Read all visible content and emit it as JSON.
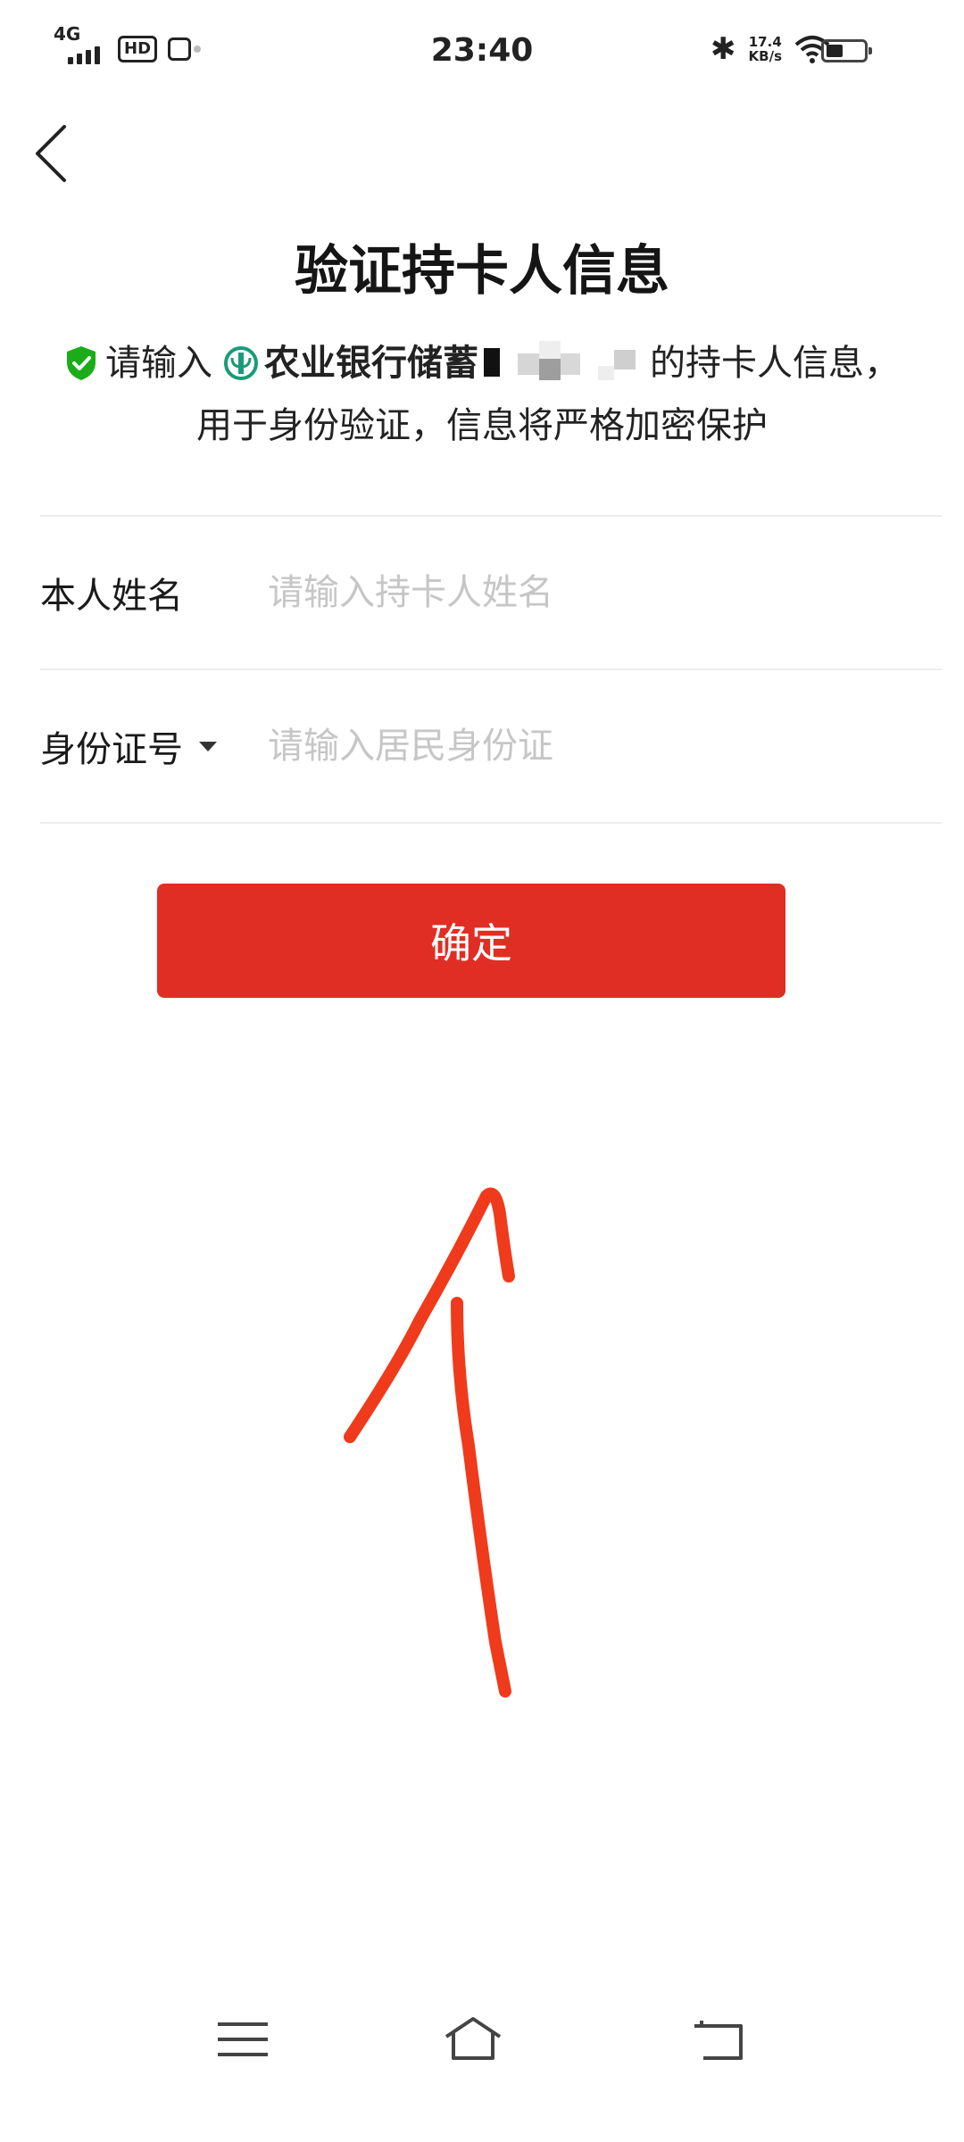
{
  "status_bar": {
    "network": "4G",
    "hd": "HD",
    "time": "23:40",
    "bluetooth": "✱",
    "speed_value": "17.4",
    "speed_unit": "KB/s",
    "icons": [
      "signal-icon",
      "hd-icon",
      "app-notification-icon",
      "bluetooth-icon",
      "wifi-icon",
      "battery-icon"
    ]
  },
  "header": {
    "back_icon": "chevron-left-icon",
    "title": "验证持卡人信息"
  },
  "description": {
    "prefix": "请输入",
    "bank_name": "农业银行储蓄",
    "suffix": "的持卡人信息，",
    "line2": "用于身份验证，信息将严格加密保护",
    "shield_color": "#1aad19",
    "bank_logo_color": "#1a9b78"
  },
  "form": {
    "name_label": "本人姓名",
    "name_placeholder": "请输入持卡人姓名",
    "name_value": "",
    "id_label": "身份证号",
    "id_placeholder": "请输入居民身份证",
    "id_value": ""
  },
  "confirm": {
    "label": "确定",
    "color": "#e02e24"
  },
  "annotation": {
    "icon": "hand-drawn-arrow-icon",
    "color": "#f03a1c"
  },
  "nav_bar": {
    "icons": [
      "menu-icon",
      "home-icon",
      "back-icon"
    ]
  }
}
